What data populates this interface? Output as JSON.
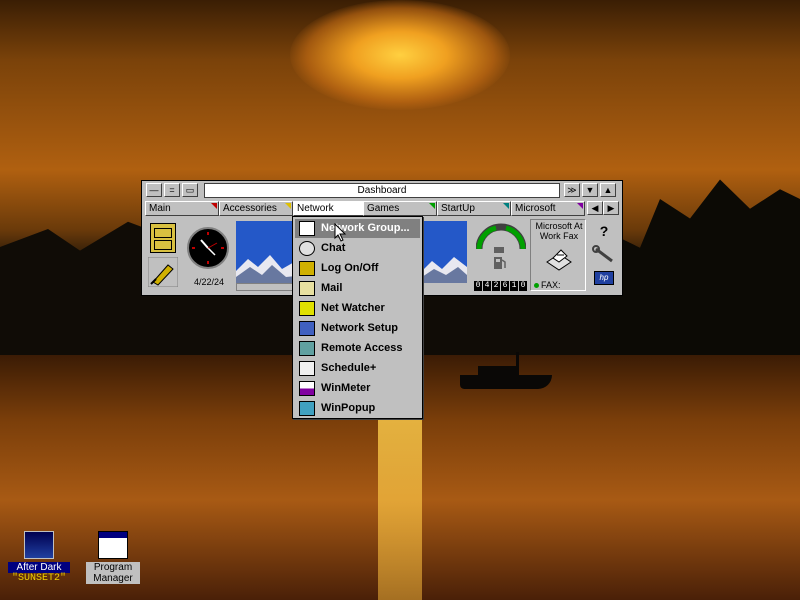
{
  "desktop": {
    "icons": [
      {
        "label": "After Dark",
        "sublabel": "\"SUNSET2\""
      },
      {
        "label": "Program Manager"
      }
    ]
  },
  "dashboard": {
    "title": "Dashboard",
    "tabs": [
      "Main",
      "Accessories",
      "Network",
      "Games",
      "StartUp",
      "Microsoft"
    ],
    "active_tab": "Network",
    "date": "4/22/24",
    "fax_title": "Microsoft At Work Fax",
    "fax_status_label": "FAX:",
    "counter_digits": [
      "0",
      "4",
      "2",
      "6",
      "1",
      "0"
    ],
    "help_glyph": "?"
  },
  "network_menu": {
    "items": [
      {
        "label": "Network Group...",
        "icon": "window-icon",
        "selected": true
      },
      {
        "label": "Chat",
        "icon": "chat-icon"
      },
      {
        "label": "Log On/Off",
        "icon": "key-icon"
      },
      {
        "label": "Mail",
        "icon": "mail-icon"
      },
      {
        "label": "Net Watcher",
        "icon": "net-watcher-icon"
      },
      {
        "label": "Network Setup",
        "icon": "network-setup-icon"
      },
      {
        "label": "Remote Access",
        "icon": "remote-access-icon"
      },
      {
        "label": "Schedule+",
        "icon": "schedule-icon"
      },
      {
        "label": "WinMeter",
        "icon": "winmeter-icon"
      },
      {
        "label": "WinPopup",
        "icon": "winpopup-icon"
      }
    ]
  },
  "colors": {
    "menu_bg": "#c0c0c0",
    "selection": "#808080",
    "sky_blue": "#1848c0"
  }
}
